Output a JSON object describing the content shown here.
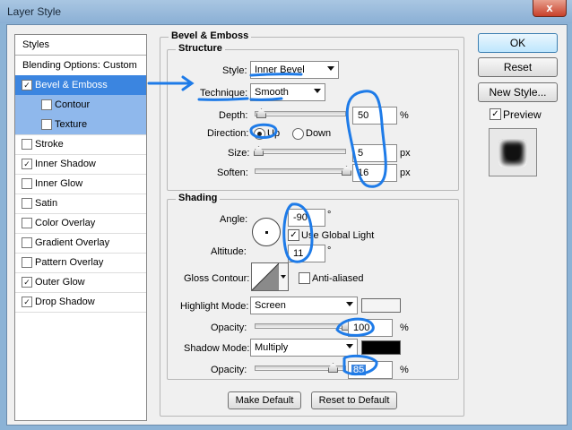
{
  "window": {
    "title": "Layer Style",
    "close_glyph": "x"
  },
  "styles_panel": {
    "header": "Styles",
    "blending": "Blending Options: Custom",
    "items": [
      {
        "label": "Bevel & Emboss",
        "checked": true
      },
      {
        "label": "Contour",
        "checked": false
      },
      {
        "label": "Texture",
        "checked": false
      },
      {
        "label": "Stroke",
        "checked": false
      },
      {
        "label": "Inner Shadow",
        "checked": true
      },
      {
        "label": "Inner Glow",
        "checked": false
      },
      {
        "label": "Satin",
        "checked": false
      },
      {
        "label": "Color Overlay",
        "checked": false
      },
      {
        "label": "Gradient Overlay",
        "checked": false
      },
      {
        "label": "Pattern Overlay",
        "checked": false
      },
      {
        "label": "Outer Glow",
        "checked": true
      },
      {
        "label": "Drop Shadow",
        "checked": true
      }
    ]
  },
  "bevel": {
    "title": "Bevel & Emboss",
    "structure_title": "Structure",
    "style_label": "Style:",
    "style_value": "Inner Bevel",
    "technique_label": "Technique:",
    "technique_value": "Smooth",
    "depth_label": "Depth:",
    "depth_value": "50",
    "depth_unit": "%",
    "depth_fraction": 0.05,
    "direction_label": "Direction:",
    "direction_up": "Up",
    "direction_down": "Down",
    "size_label": "Size:",
    "size_value": "5",
    "size_unit": "px",
    "size_fraction": 0.02,
    "soften_label": "Soften:",
    "soften_value": "16",
    "soften_unit": "px",
    "soften_fraction": 1.0
  },
  "shading": {
    "title": "Shading",
    "angle_label": "Angle:",
    "angle_value": "-90",
    "angle_unit": "°",
    "global_light_label": "Use Global Light",
    "global_light_checked": true,
    "altitude_label": "Altitude:",
    "altitude_value": "11",
    "altitude_unit": "°",
    "gloss_contour_label": "Gloss Contour:",
    "anti_aliased_label": "Anti-aliased",
    "anti_aliased_checked": false,
    "highlight_mode_label": "Highlight Mode:",
    "highlight_mode_value": "Screen",
    "highlight_color": "#f4f4f4",
    "highlight_opacity_label": "Opacity:",
    "highlight_opacity_value": "100",
    "highlight_opacity_unit": "%",
    "highlight_opacity_fraction": 1.0,
    "shadow_mode_label": "Shadow Mode:",
    "shadow_mode_value": "Multiply",
    "shadow_color": "#000000",
    "shadow_opacity_label": "Opacity:",
    "shadow_opacity_value": "85",
    "shadow_opacity_unit": "%",
    "shadow_opacity_fraction": 0.85
  },
  "footer": {
    "make_default": "Make Default",
    "reset_default": "Reset to Default"
  },
  "buttons": {
    "ok": "OK",
    "reset": "Reset",
    "new_style": "New Style...",
    "preview_label": "Preview",
    "preview_checked": true
  },
  "colors": {
    "annotation": "#1e7be8",
    "selection": "#3b85e0"
  }
}
